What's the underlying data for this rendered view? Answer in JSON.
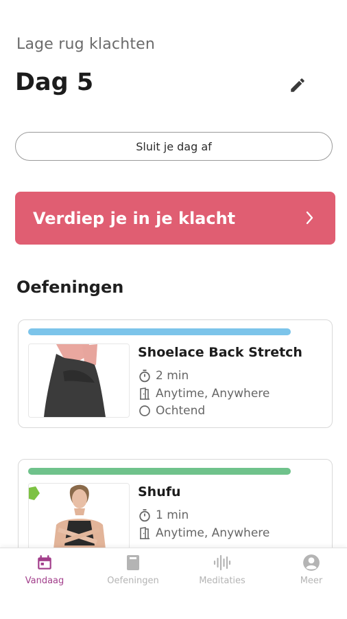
{
  "header": {
    "subtitle": "Lage rug klachten",
    "title": "Dag 5",
    "edit_icon": "pencil-icon"
  },
  "close_day_button": "Sluit je dag af",
  "deepen_banner": {
    "label": "Verdiep je in je klacht",
    "color": "#e05e72",
    "icon": "chevron-right-icon"
  },
  "exercises": {
    "section_title": "Oefeningen",
    "items": [
      {
        "name": "Shoelace Back Stretch",
        "duration": "2 min",
        "location": "Anytime, Anywhere",
        "time_of_day": "Ochtend",
        "bar_color": "#7cc4ea"
      },
      {
        "name": "Shufu",
        "duration": "1 min",
        "location": "Anytime, Anywhere",
        "bar_color": "#6fc28b"
      }
    ]
  },
  "bottom_nav": {
    "active_color": "#a23e8b",
    "inactive_color": "#b4b4b4",
    "items": [
      {
        "label": "Vandaag",
        "icon": "calendar-icon",
        "active": true
      },
      {
        "label": "Oefeningen",
        "icon": "book-icon",
        "active": false
      },
      {
        "label": "Meditaties",
        "icon": "soundwave-icon",
        "active": false
      },
      {
        "label": "Meer",
        "icon": "profile-icon",
        "active": false
      }
    ]
  }
}
